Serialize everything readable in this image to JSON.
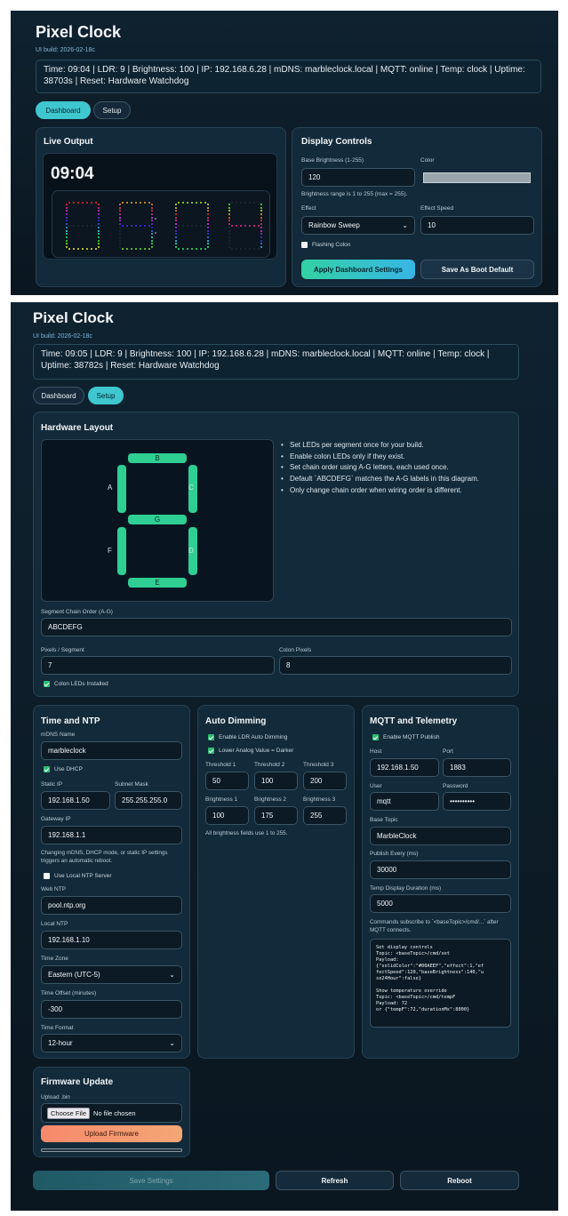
{
  "screen1": {
    "app_title": "Pixel Clock",
    "build": "UI build: 2026-02-18c",
    "status": "Time: 09:04 | LDR: 9 | Brightness: 100 | IP: 192.168.6.28 | mDNS: marbleclock.local | MQTT: online | Temp: clock | Uptime: 38703s | Reset: Hardware Watchdog",
    "tabs": {
      "dashboard": "Dashboard",
      "setup": "Setup"
    },
    "live": {
      "title": "Live Output",
      "time": "09:04",
      "digits": "09:04"
    },
    "controls": {
      "title": "Display Controls",
      "base_label": "Base Brightness (1-255)",
      "base_value": "120",
      "color_label": "Color",
      "color_value": "#9aa4ab",
      "range_note": "Brightness range is 1 to 255 (max = 255).",
      "effect_label": "Effect",
      "effect_value": "Rainbow Sweep",
      "speed_label": "Effect Speed",
      "speed_value": "10",
      "flashing_label": "Flashing Colon",
      "apply_label": "Apply Dashboard Settings",
      "boot_label": "Save As Boot Default"
    }
  },
  "screen2": {
    "app_title": "Pixel Clock",
    "build": "UI build: 2026-02-18c",
    "status": "Time: 09:05 | LDR: 9 | Brightness: 100 | IP: 192.168.6.28 | mDNS: marbleclock.local | MQTT: online | Temp: clock | Uptime: 38782s | Reset: Hardware Watchdog",
    "tabs": {
      "dashboard": "Dashboard",
      "setup": "Setup"
    },
    "hardware": {
      "title": "Hardware Layout",
      "segments": {
        "a": "A",
        "b": "B",
        "c": "C",
        "d": "D",
        "e": "E",
        "f": "F",
        "g": "G"
      },
      "tips": [
        "Set LEDs per segment once for your build.",
        "Enable colon LEDs only if they exist.",
        "Set chain order using A-G letters, each used once.",
        "Default `ABCDEFG` matches the A-G labels in this diagram.",
        "Only change chain order when wiring order is different."
      ],
      "chain_label": "Segment Chain Order (A-G)",
      "chain_value": "ABCDEFG",
      "pixels_label": "Pixels / Segment",
      "pixels_value": "7",
      "colon_label": "Colon Pixels",
      "colon_value": "8",
      "colon_installed": "Colon LEDs Installed"
    },
    "time": {
      "title": "Time and NTP",
      "mdns_label": "mDNS Name",
      "mdns_value": "marbleclock",
      "dhcp": "Use DHCP",
      "static_label": "Static IP",
      "static_value": "192.168.1.50",
      "subnet_label": "Subnet Mask",
      "subnet_value": "255.255.255.0",
      "gateway_label": "Gateway IP",
      "gateway_value": "192.168.1.1",
      "reboot_note": "Changing mDNS, DHCP mode, or static IP settings triggers an automatic reboot.",
      "local_ntp_check": "Use Local NTP Server",
      "web_ntp_label": "Web NTP",
      "web_ntp_value": "pool.ntp.org",
      "local_ntp_label": "Local NTP",
      "local_ntp_value": "192.168.1.10",
      "tz_label": "Time Zone",
      "tz_value": "Eastern (UTC-5)",
      "offset_label": "Time Offset (minutes)",
      "offset_value": "-300",
      "format_label": "Time Format",
      "format_value": "12-hour"
    },
    "dimming": {
      "title": "Auto Dimming",
      "enable": "Enable LDR Auto Dimming",
      "lower": "Lower Analog Value = Darker",
      "t1_label": "Threshold 1",
      "t1": "50",
      "t2_label": "Threshold 2",
      "t2": "100",
      "t3_label": "Threshold 3",
      "t3": "200",
      "b1_label": "Brightness 1",
      "b1": "100",
      "b2_label": "Brightness 2",
      "b2": "175",
      "b3_label": "Brightness 3",
      "b3": "255",
      "note": "All brightness fields use 1 to 255."
    },
    "mqtt": {
      "title": "MQTT and Telemetry",
      "enable": "Enable MQTT Publish",
      "host_label": "Host",
      "host": "192.168.1.50",
      "port_label": "Port",
      "port": "1883",
      "user_label": "User",
      "user": "mqtt",
      "pass_label": "Password",
      "pass": "••••••••••",
      "topic_label": "Base Topic",
      "topic": "MarbleClock",
      "publish_label": "Publish Every (ms)",
      "publish": "30000",
      "temp_label": "Temp Display Duration (ms)",
      "temp": "5000",
      "cmd_note": "Commands subscribe to `<baseTopic>/cmd/...` after MQTT connects.",
      "code": "Set display controls\nTopic: <baseTopic>/cmd/set\nPayload:\n{\"solidColor\":\"#00AEEF\",\"effect\":1,\"ef\nfectSpeed\":120,\"baseBrightness\":140,\"u\nse24Hour\":false}\n\nShow temperature override\nTopic: <baseTopic>/cmd/tempF\nPayload: 72\nor {\"tempF\":72,\"durationMs\":8000}"
    },
    "firmware": {
      "title": "Firmware Update",
      "upload_label": "Upload .bin",
      "choose": "Choose File",
      "no_file": "No file chosen",
      "upload_btn": "Upload Firmware",
      "progress": 0
    },
    "footer": {
      "save": "Save Settings",
      "refresh": "Refresh",
      "reboot": "Reboot"
    }
  }
}
